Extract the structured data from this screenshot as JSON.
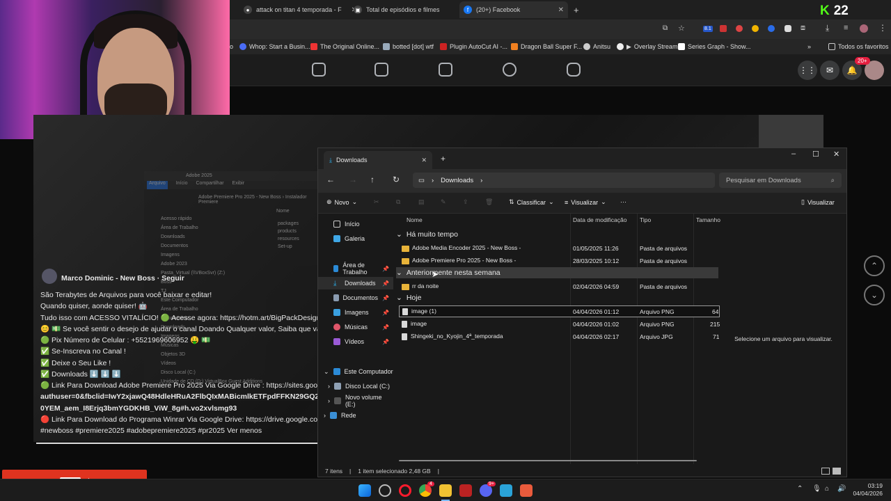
{
  "browser": {
    "tabs": [
      {
        "label": "attack on titan 4 temporada - F"
      },
      {
        "label": "Total de episódios e filmes"
      },
      {
        "label": "(20+) Facebook"
      }
    ],
    "bookmarks": [
      "Whop: Start a Busin...",
      "The Original Online...",
      "botted [dot] wtf",
      "Plugin AutoCut AI -...",
      "Dragon Ball Super F...",
      "Anitsu",
      "Overlay Stream",
      "Series Graph - Show...",
      "Todos os favoritos"
    ],
    "notification_count": "20+",
    "ext_badge": "8.1"
  },
  "kick": {
    "letter": "K",
    "count": "22"
  },
  "post": {
    "author": "Marco Dominic - New Boss",
    "follow": "Seguir",
    "lines": [
      "São Terabytes de Arquivos para você baixar e editar!",
      "Quando quiser, aonde quiser! 🤖",
      "Tudo isso com ACESSO VITALÍCIO! 🟢 Acesse agora: https://hotm.art/BigPackDesignerOF",
      "😊 💵 Se você sentir o desejo de ajudar o canal Doando Qualquer valor, Saiba que vai aju",
      "🟢 Pix Número de Celular : +5521969606952 🤑 💵",
      "✅ Se-Inscreva no Canal !",
      "✅ Deixe o Seu Like !",
      "✅  Downloads ⬇️ ⬇️ ⬇️",
      "🟢 Link Para Download Adobe Premiere Pro 2025 Via Google Drive : https://sites.google.c",
      "authuser=0&fbclid=IwY2xjawQ48HdleHRuA2FlbQIxMABicmlkETFpdFFKN29GQ25MZDN",
      "0YEM_aem_I8Erjq3bmYGDKHB_ViW_8g#h.vo2xvlsmg93",
      "🔴 Link Para Download do Programa Winrar Via Google Drive: https://drive.google.com/",
      "#newboss #premiere2025 #adobepremiere2025 #pr2025 Ver menos"
    ]
  },
  "old_explorer": {
    "title": "Adobe 2025",
    "ribbon": [
      "Arquivo",
      "Início",
      "Compartilhar",
      "Exibir"
    ],
    "path": "Adobe Premiere Pro 2025 - New Boss  ›  Instalador Premiere",
    "tree": [
      "Acesso rápido",
      "Área de Trabalho",
      "Downloads",
      "Documentos",
      "Imagens",
      "Adobe 2023",
      "Pasta_Virtual (\\\\VBoxSvr) (Z:)",
      "Boss",
      "TJ",
      "Este Computador",
      "Área de Trabalho",
      "Documentos",
      "Downloads",
      "Imagens",
      "Músicas",
      "Objetos 3D",
      "Vídeos",
      "Disco Local (C:)",
      "Unidade de CD (D:) VirtualBox Guest Additions"
    ],
    "col_name": "Nome",
    "files": [
      "packages",
      "products",
      "resources",
      "Set-up"
    ]
  },
  "explorer": {
    "tab_title": "Downloads",
    "breadcrumb": "Downloads",
    "search_placeholder": "Pesquisar em Downloads",
    "toolbar": {
      "new": "Novo",
      "sort": "Classificar",
      "view": "Visualizar",
      "more": "···",
      "details": "Visualizar"
    },
    "sidebar": [
      {
        "label": "Início",
        "pinned": false
      },
      {
        "label": "Galeria",
        "pinned": false
      },
      {
        "label": "Área de Trabalho",
        "pinned": true
      },
      {
        "label": "Downloads",
        "pinned": true
      },
      {
        "label": "Documentos",
        "pinned": true
      },
      {
        "label": "Imagens",
        "pinned": true
      },
      {
        "label": "Músicas",
        "pinned": true
      },
      {
        "label": "Vídeos",
        "pinned": true
      },
      {
        "label": "Este Computador",
        "pinned": false
      },
      {
        "label": "Disco Local (C:)",
        "pinned": false
      },
      {
        "label": "Novo volume (E:)",
        "pinned": false
      },
      {
        "label": "Rede",
        "pinned": false
      }
    ],
    "columns": [
      "Nome",
      "Data de modificação",
      "Tipo",
      "Tamanho"
    ],
    "groups": [
      {
        "label": "Há muito tempo",
        "rows": [
          {
            "name": "Adobe Media Encoder 2025 - New Boss -",
            "date": "01/05/2025 11:26",
            "type": "Pasta de arquivos",
            "size": "",
            "kind": "folder"
          },
          {
            "name": "Adobe Premiere Pro 2025 - New Boss -",
            "date": "28/03/2025 10:12",
            "type": "Pasta de arquivos",
            "size": "",
            "kind": "folder"
          }
        ]
      },
      {
        "label": "Anteriormente nesta semana",
        "rows": [
          {
            "name": "rr da noite",
            "date": "02/04/2026 04:59",
            "type": "Pasta de arquivos",
            "size": "",
            "kind": "folder"
          }
        ]
      },
      {
        "label": "Hoje",
        "rows": [
          {
            "name": "image (1)",
            "date": "04/04/2026 01:12",
            "type": "Arquivo PNG",
            "size": "64",
            "kind": "file"
          },
          {
            "name": "image",
            "date": "04/04/2026 01:02",
            "type": "Arquivo PNG",
            "size": "215",
            "kind": "file"
          },
          {
            "name": "Shingeki_no_Kyojin_4ª_temporada",
            "date": "04/04/2026 02:17",
            "type": "Arquivo JPG",
            "size": "71",
            "kind": "file"
          }
        ]
      }
    ],
    "preview_text": "Selecione um arquivo para visualizar.",
    "status_count": "7 itens",
    "status_selected": "1 item selecionado  2,48 GB"
  },
  "taskbar": {
    "time": "03:19",
    "date": "04/04/2026",
    "browser_badge": "4",
    "discord_badge": "9+"
  }
}
